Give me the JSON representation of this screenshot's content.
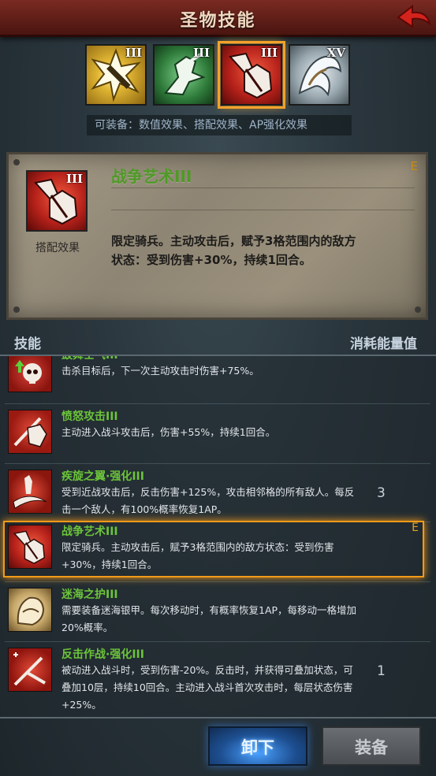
{
  "header": {
    "title": "圣物技能"
  },
  "relics": [
    {
      "rank": "III",
      "icon": "burst-axe-icon",
      "color": "#c99a1a"
    },
    {
      "rank": "III",
      "icon": "horse-charge-icon",
      "color": "#3f8f4a"
    },
    {
      "rank": "III",
      "icon": "war-art-icon",
      "color": "#c72e24",
      "selected": true
    },
    {
      "rank": "XV",
      "icon": "coiled-beast-icon",
      "color": "#b8c2c8"
    }
  ],
  "equip_hint": "可装备：数值效果、搭配效果、AP强化效果",
  "detail": {
    "rank": "III",
    "type": "搭配效果",
    "name": "战争艺术III",
    "grade": "E",
    "desc_line1": "限定骑兵。主动攻击后，赋予3格范围内的敌方",
    "desc_line2": "状态：受到伤害+30%，持续1回合。"
  },
  "list_header": {
    "left": "技能",
    "right": "消耗能量值"
  },
  "skills": [
    {
      "name": "鼓舞士气III",
      "desc": "击杀目标后，下一次主动攻击时伤害+75%。",
      "cost": "",
      "grade": "",
      "icon": "skull-buff-icon"
    },
    {
      "name": "愤怒攻击III",
      "desc": "主动进入战斗攻击后，伤害+55%，持续1回合。",
      "cost": "",
      "grade": "",
      "icon": "rage-strike-icon"
    },
    {
      "name": "疾旋之翼·强化III",
      "desc": "受到近战攻击后，反击伤害+125%，攻击相邻格的所有敌人。每反击一个敌人，有100%概率恢复1AP。",
      "cost": "3",
      "grade": "",
      "icon": "whirl-wing-icon"
    },
    {
      "name": "战争艺术III",
      "desc": "限定骑兵。主动攻击后，赋予3格范围内的敌方状态：受到伤害+30%，持续1回合。",
      "cost": "",
      "grade": "E",
      "icon": "war-art-icon",
      "selected": true
    },
    {
      "name": "迷海之护III",
      "desc": "需要装备迷海银甲。每次移动时，有概率恢复1AP，每移动一格增加20%概率。",
      "cost": "",
      "grade": "",
      "icon": "sea-guard-icon"
    },
    {
      "name": "反击作战·强化III",
      "desc": "被动进入战斗时，受到伤害-20%。反击时，并获得可叠加状态，可叠加10层，持续10回合。主动进入战斗首次攻击时，每层状态伤害+25%。",
      "cost": "1",
      "grade": "",
      "icon": "counter-op-icon"
    }
  ],
  "buttons": {
    "unload": "卸下",
    "equip": "装备"
  }
}
